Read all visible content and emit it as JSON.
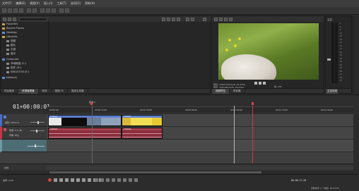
{
  "menu": [
    "文件(F)",
    "编辑(E)",
    "视图(V)",
    "插入(I)",
    "工具(T)",
    "选项(O)",
    "帮助(H)"
  ],
  "explorer": {
    "items": [
      {
        "label": "Favorites",
        "icon": "star-icon",
        "indent": 0
      },
      {
        "label": "Recent Places",
        "icon": "folder-icon",
        "indent": 0
      },
      {
        "label": "Desktop",
        "icon": "folder-icon",
        "indent": 0
      },
      {
        "label": "Libraries",
        "icon": "folder-icon",
        "indent": 0
      },
      {
        "label": "视频",
        "icon": "folder-icon",
        "indent": 1
      },
      {
        "label": "图片",
        "icon": "folder-icon",
        "indent": 1
      },
      {
        "label": "文档",
        "icon": "folder-icon",
        "indent": 1
      },
      {
        "label": "音乐",
        "icon": "folder-icon",
        "indent": 1
      },
      {
        "label": "Computer",
        "icon": "computer-icon",
        "indent": 0
      },
      {
        "label": "本地磁盘 (C:)",
        "icon": "drive-icon",
        "indent": 1
      },
      {
        "label": "软件 (D:)",
        "icon": "drive-icon",
        "indent": 1
      },
      {
        "label": "KINGSTON (E:)",
        "icon": "drive-icon",
        "indent": 1
      },
      {
        "label": "Network",
        "icon": "network-icon",
        "indent": 0
      }
    ],
    "tabs": [
      "项目媒体",
      "资源管理器",
      "转场",
      "视频 FX",
      "媒体生成器"
    ]
  },
  "preview": {
    "info_left": [
      "项目: 1280x720x128, 29.970p",
      "预览: 320x180x128, 29.970p",
      "显示: 275x155x32"
    ],
    "info_right": [
      "帧: 335",
      "显示: 275x155x32"
    ],
    "tabs": [
      "视频预览",
      "修剪器"
    ]
  },
  "master": {
    "title": "主控",
    "scale": [
      "-3",
      "-6",
      "-9",
      "-12",
      "-15",
      "-18",
      "-21",
      "-24",
      "-27",
      "-30",
      "-33",
      "-36",
      "-39",
      "-42",
      "-45",
      "-48",
      "-51",
      "-54",
      "-57"
    ],
    "tab": "主控总线"
  },
  "timeline": {
    "timecode": "01+00:00:01",
    "region_label": "区域 1",
    "ruler_labels": [
      "00:00:00",
      "00:00:15:00",
      "00:00:30:00",
      "00:00:45:00",
      "00:01:00:00",
      "00:01:15:00",
      "00:01:30:00"
    ],
    "track1": {
      "level": "级别: 100.0 %"
    },
    "track2": {
      "vol": "音量: 0.0 dB",
      "pan": "声像: 中心"
    },
    "clips": {
      "video1": "Untitled",
      "video2": "Untitled",
      "audio1": "Untitled",
      "audio2": "Untitled"
    },
    "bus_label": "总线",
    "rate": "速率: 0.00",
    "status_time": "00:00:17;26",
    "record_time": "录制时间 (2 个通道): 80:27:05"
  }
}
